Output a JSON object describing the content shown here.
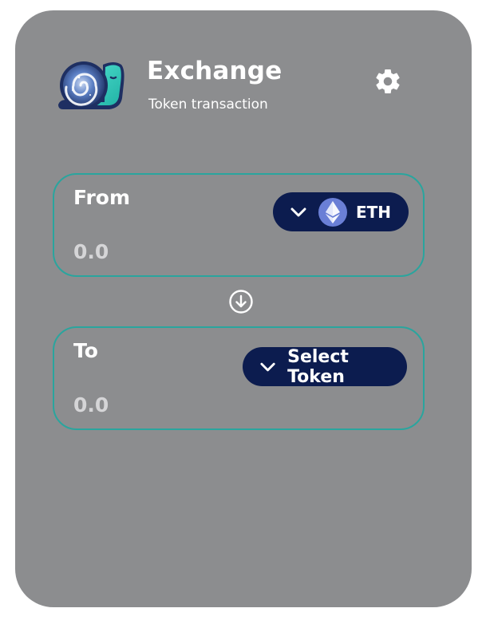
{
  "header": {
    "title": "Exchange",
    "subtitle": "Token transaction"
  },
  "icons": {
    "logo": "snail-logo",
    "settings": "gear-icon",
    "swap": "arrow-down-circle-icon",
    "token_eth": "ethereum-icon",
    "dropdown": "chevron-down-icon"
  },
  "from": {
    "label": "From",
    "value": "0.0",
    "token_label": "ETH"
  },
  "to": {
    "label": "To",
    "value": "0.0",
    "token_label": "Select Token"
  },
  "colors": {
    "card_background": "#8c8d8f",
    "panel_border": "#2aa59e",
    "token_button": "#0c1c4f",
    "eth_badge": "#6a7fd6"
  }
}
